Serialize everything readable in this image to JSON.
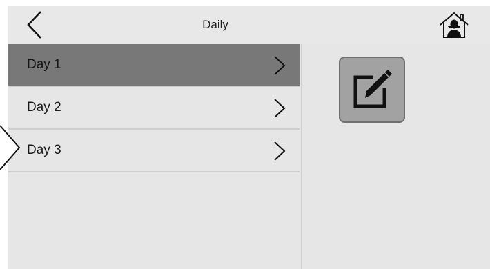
{
  "header": {
    "title": "Daily",
    "back_icon": "chevron-left-icon",
    "home_icon": "home-user-icon"
  },
  "list": {
    "items": [
      {
        "label": "Day 1",
        "selected": true,
        "icon": "chevron-right-icon"
      },
      {
        "label": "Day 2",
        "selected": false,
        "icon": "chevron-right-icon"
      },
      {
        "label": "Day 3",
        "selected": false,
        "icon": "chevron-right-icon"
      }
    ]
  },
  "actions": {
    "edit_icon": "edit-icon"
  },
  "colors": {
    "background": "#e6e6e6",
    "selected_row": "#787878",
    "edit_button": "#a2a2a2",
    "divider": "#cfcfcf"
  }
}
